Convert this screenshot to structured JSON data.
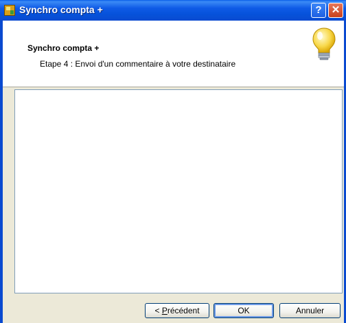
{
  "window": {
    "title": "Synchro compta +",
    "help_label": "?",
    "close_label": "✕"
  },
  "header": {
    "title": "Synchro compta +",
    "step": "Etape 4 : Envoi d'un commentaire à votre destinataire",
    "icon": "lightbulb-icon"
  },
  "comment": {
    "value": ""
  },
  "buttons": {
    "prev_prefix": "< ",
    "prev_label_u": "P",
    "prev_label_rest": "récédent",
    "ok": "OK",
    "cancel": "Annuler"
  },
  "colors": {
    "titlebar": "#0a5fe8",
    "dialog_bg": "#ece9d8",
    "field_border": "#7f9db9",
    "bulb": "#f8d84a"
  }
}
